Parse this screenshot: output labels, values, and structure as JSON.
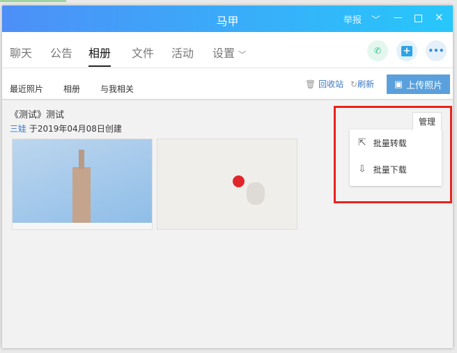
{
  "window": {
    "title": "马甲",
    "report": "举报"
  },
  "tabs": [
    {
      "label": "聊天"
    },
    {
      "label": "公告"
    },
    {
      "label": "相册"
    },
    {
      "label": "文件"
    },
    {
      "label": "活动"
    },
    {
      "label": "设置"
    }
  ],
  "subnav": {
    "items": [
      "最近照片",
      "相册",
      "与我相关"
    ],
    "recycle": "回收站",
    "refresh": "刷新",
    "upload": "上传照片"
  },
  "album": {
    "title": "《测试》测试",
    "creator": "三娃",
    "created": "于2019年04月08日创建"
  },
  "manage": {
    "label": "管理",
    "menu": [
      "批量转载",
      "批量下载"
    ]
  },
  "colors": {
    "accent": "#5aa0dc",
    "highlight": "#e8231c"
  }
}
